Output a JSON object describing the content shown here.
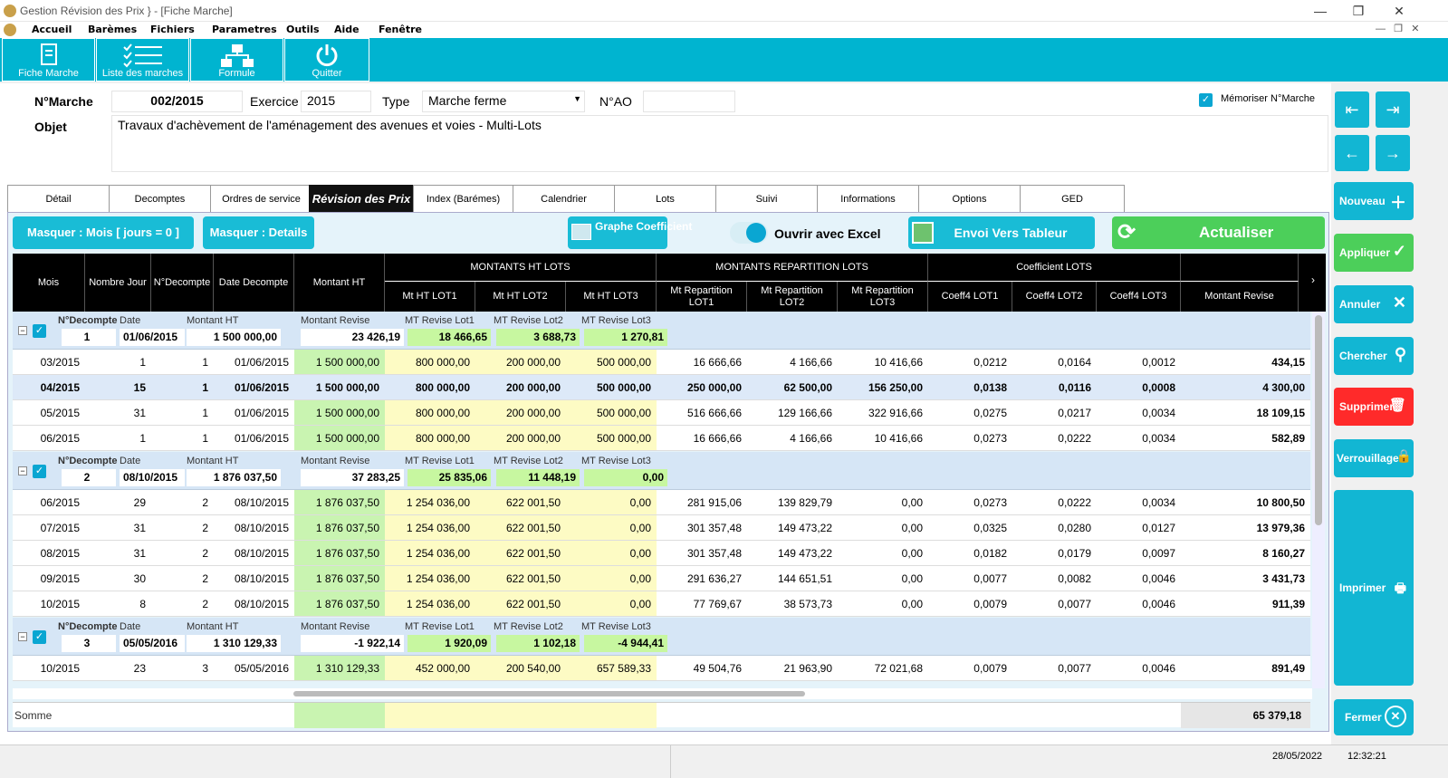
{
  "titlebar": {
    "title": "Gestion Révision des Prix    } - [Fiche Marche]",
    "minimize": "—",
    "maximize": "❐",
    "close": "✕"
  },
  "menu": [
    "Accueil",
    "Barèmes",
    "Fichiers",
    "Parametres",
    "Outils",
    "Aide",
    "Fenêtre"
  ],
  "ribbon": {
    "fiche_marche": "Fiche Marche",
    "liste_marches": "Liste des marches",
    "formule": "Formule",
    "quitter": "Quitter"
  },
  "form": {
    "n_marche_label": "N°Marche",
    "n_marche": "002/2015",
    "exercice_label": "Exercice",
    "exercice": "2015",
    "type_label": "Type",
    "type": "Marche ferme",
    "nao_label": "N°AO",
    "nao": "",
    "objet_label": "Objet",
    "objet": "Travaux d'achèvement de l'aménagement des avenues et voies - Multi-Lots",
    "memoriser": "Mémoriser N°Marche"
  },
  "tabs": [
    "Détail",
    "Decomptes",
    "Ordres de service",
    "Révision des Prix",
    "Index (Barémes)",
    "Calendrier",
    "Lots",
    "Suivi",
    "Informations",
    "Options",
    "GED"
  ],
  "toolbar": {
    "masquer_mois": "Masquer : Mois [ jours = 0 ]",
    "masquer_details": "Masquer : Details",
    "graphe": "Graphe Coefficient",
    "ouvrir_excel": "Ouvrir avec Excel",
    "envoi": "Envoi Vers Tableur",
    "actualiser": "Actualiser"
  },
  "side": {
    "nouveau": "Nouveau",
    "appliquer": "Appliquer",
    "annuler": "Annuler",
    "chercher": "Chercher",
    "supprimer": "Supprimer",
    "verrouillage": "Verrouillage",
    "imprimer": "Imprimer",
    "fermer": "Fermer"
  },
  "grid": {
    "headers": {
      "mois": "Mois",
      "nombre_jour": "Nombre Jour",
      "n_decompte": "N°Decompte",
      "date_decompte": "Date Decompte",
      "montant_ht": "Montant HT",
      "montants_ht_lots": "MONTANTS HT LOTS",
      "mt_ht_lot1": "Mt HT LOT1",
      "mt_ht_lot2": "Mt HT LOT2",
      "mt_ht_lot3": "Mt HT LOT3",
      "montants_rep": "MONTANTS REPARTITION LOTS",
      "rep1": "Mt Repartition LOT1",
      "rep2": "Mt Repartition LOT2",
      "rep3": "Mt Repartition LOT3",
      "coef": "Coefficient LOTS",
      "c1": "Coeff4 LOT1",
      "c2": "Coeff4 LOT2",
      "c3": "Coeff4 LOT3",
      "montant_revise": "Montant Revise"
    },
    "group_labels": {
      "ndec": "N°Decompte",
      "date": "Date",
      "mht": "Montant HT",
      "mrev": "Montant Revise",
      "l1": "MT Revise Lot1",
      "l2": "MT Revise Lot2",
      "l3": "MT Revise Lot3"
    },
    "groups": [
      {
        "ndec": "1",
        "date": "01/06/2015",
        "mht": "1 500 000,00",
        "mrev": "23 426,19",
        "l1": "18 466,65",
        "l2": "3 688,73",
        "l3": "1 270,81"
      },
      {
        "ndec": "2",
        "date": "08/10/2015",
        "mht": "1 876 037,50",
        "mrev": "37 283,25",
        "l1": "25 835,06",
        "l2": "11 448,19",
        "l3": "0,00"
      },
      {
        "ndec": "3",
        "date": "05/05/2016",
        "mht": "1 310 129,33",
        "mrev": "-1 922,14",
        "l1": "1 920,09",
        "l2": "1 102,18",
        "l3": "-4 944,41"
      }
    ],
    "rows": [
      [
        "03/2015",
        "1",
        "1",
        "01/06/2015",
        "1 500 000,00",
        "800 000,00",
        "200 000,00",
        "500 000,00",
        "16 666,66",
        "4 166,66",
        "10 416,66",
        "0,0212",
        "0,0164",
        "0,0012",
        "434,15"
      ],
      [
        "04/2015",
        "15",
        "1",
        "01/06/2015",
        "1 500 000,00",
        "800 000,00",
        "200 000,00",
        "500 000,00",
        "250 000,00",
        "62 500,00",
        "156 250,00",
        "0,0138",
        "0,0116",
        "0,0008",
        "4 300,00"
      ],
      [
        "05/2015",
        "31",
        "1",
        "01/06/2015",
        "1 500 000,00",
        "800 000,00",
        "200 000,00",
        "500 000,00",
        "516 666,66",
        "129 166,66",
        "322 916,66",
        "0,0275",
        "0,0217",
        "0,0034",
        "18 109,15"
      ],
      [
        "06/2015",
        "1",
        "1",
        "01/06/2015",
        "1 500 000,00",
        "800 000,00",
        "200 000,00",
        "500 000,00",
        "16 666,66",
        "4 166,66",
        "10 416,66",
        "0,0273",
        "0,0222",
        "0,0034",
        "582,89"
      ],
      [
        "06/2015",
        "29",
        "2",
        "08/10/2015",
        "1 876 037,50",
        "1 254 036,00",
        "622 001,50",
        "0,00",
        "281 915,06",
        "139 829,79",
        "0,00",
        "0,0273",
        "0,0222",
        "0,0034",
        "10 800,50"
      ],
      [
        "07/2015",
        "31",
        "2",
        "08/10/2015",
        "1 876 037,50",
        "1 254 036,00",
        "622 001,50",
        "0,00",
        "301 357,48",
        "149 473,22",
        "0,00",
        "0,0325",
        "0,0280",
        "0,0127",
        "13 979,36"
      ],
      [
        "08/2015",
        "31",
        "2",
        "08/10/2015",
        "1 876 037,50",
        "1 254 036,00",
        "622 001,50",
        "0,00",
        "301 357,48",
        "149 473,22",
        "0,00",
        "0,0182",
        "0,0179",
        "0,0097",
        "8 160,27"
      ],
      [
        "09/2015",
        "30",
        "2",
        "08/10/2015",
        "1 876 037,50",
        "1 254 036,00",
        "622 001,50",
        "0,00",
        "291 636,27",
        "144 651,51",
        "0,00",
        "0,0077",
        "0,0082",
        "0,0046",
        "3 431,73"
      ],
      [
        "10/2015",
        "8",
        "2",
        "08/10/2015",
        "1 876 037,50",
        "1 254 036,00",
        "622 001,50",
        "0,00",
        "77 769,67",
        "38 573,73",
        "0,00",
        "0,0079",
        "0,0077",
        "0,0046",
        "911,39"
      ],
      [
        "10/2015",
        "23",
        "3",
        "05/05/2016",
        "1 310 129,33",
        "452 000,00",
        "200 540,00",
        "657 589,33",
        "49 504,76",
        "21 963,90",
        "72 021,68",
        "0,0079",
        "0,0077",
        "0,0046",
        "891,49"
      ]
    ],
    "somme_label": "Somme",
    "somme": "65 379,18"
  },
  "status": {
    "date": "28/05/2022",
    "time": "12:32:21"
  },
  "colors": {
    "accent": "#00b4d0",
    "green": "#4ccf5a",
    "red": "#ff2a2a"
  }
}
